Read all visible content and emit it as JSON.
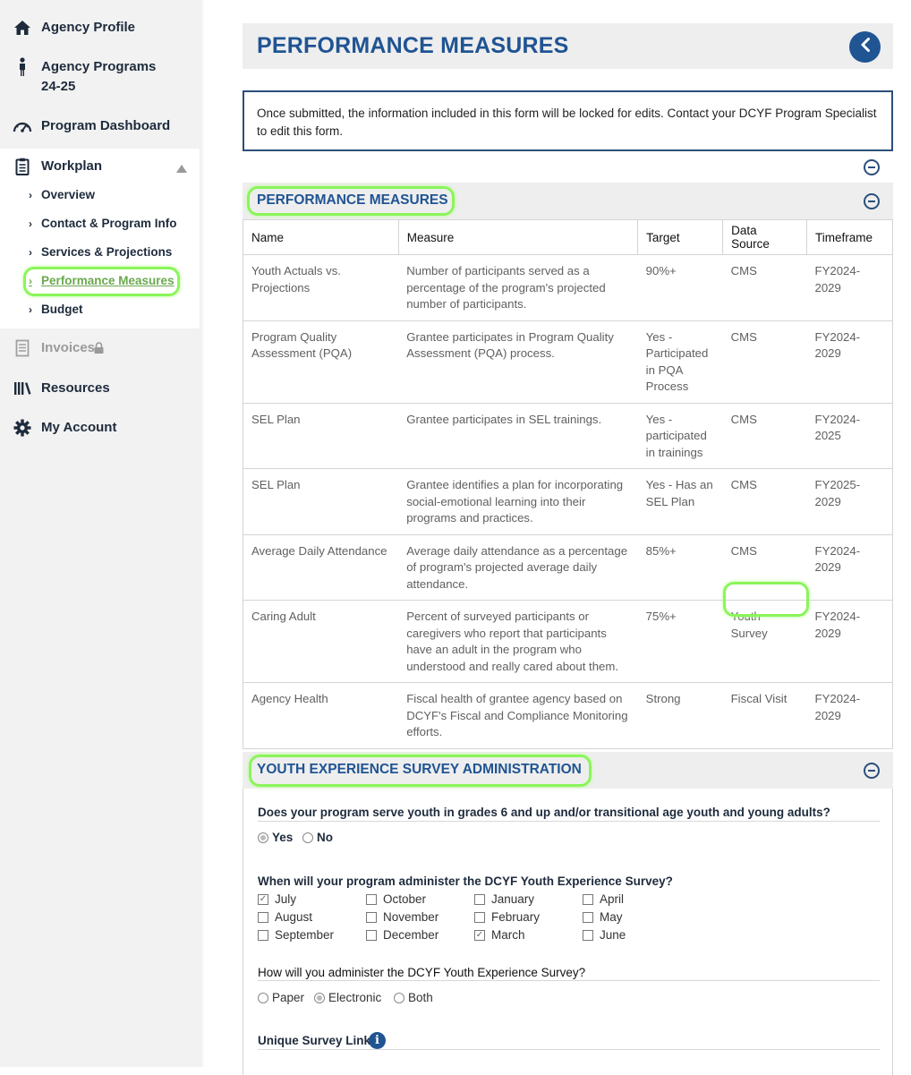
{
  "sidebar": {
    "items": [
      {
        "label": "Agency Profile",
        "icon": "home-icon"
      },
      {
        "label": "Agency Programs 24-25",
        "icon": "person-icon"
      },
      {
        "label": "Program Dashboard",
        "icon": "gauge-icon"
      },
      {
        "label": "Workplan",
        "icon": "clipboard-icon"
      },
      {
        "label": "Invoices",
        "icon": "invoice-icon",
        "locked": true
      },
      {
        "label": "Resources",
        "icon": "books-icon"
      },
      {
        "label": "My Account",
        "icon": "gear-icon"
      }
    ],
    "workplan_sub": [
      {
        "label": "Overview"
      },
      {
        "label": "Contact & Program Info"
      },
      {
        "label": "Services & Projections"
      },
      {
        "label": "Performance Measures",
        "active": true
      },
      {
        "label": "Budget"
      }
    ],
    "agency_programs_line1": "Agency Programs",
    "agency_programs_line2": "24-25"
  },
  "header": {
    "title": "PERFORMANCE MEASURES"
  },
  "notice": {
    "text": "Once submitted, the information included in this form will be locked for edits. Contact your DCYF Program Specialist to edit this form."
  },
  "performance_section": {
    "title": "PERFORMANCE MEASURES",
    "columns": [
      "Name",
      "Measure",
      "Target",
      "Data Source",
      "Timeframe"
    ],
    "rows": [
      {
        "name": "Youth Actuals vs. Projections",
        "measure": "Number of participants served as a percentage of the program's projected number of participants.",
        "target": "90%+",
        "source": "CMS",
        "timeframe": "FY2024-2029"
      },
      {
        "name": "Program Quality Assessment (PQA)",
        "measure": "Grantee participates in Program Quality Assessment (PQA) process.",
        "target": "Yes - Participated in PQA Process",
        "source": "CMS",
        "timeframe": "FY2024-2029"
      },
      {
        "name": "SEL Plan",
        "measure": "Grantee participates in SEL trainings.",
        "target": "Yes - participated in trainings",
        "source": "CMS",
        "timeframe": "FY2024-2025"
      },
      {
        "name": "SEL Plan",
        "measure": "Grantee identifies a plan for incorporating social-emotional learning into their programs and practices.",
        "target": "Yes - Has an SEL Plan",
        "source": "CMS",
        "timeframe": "FY2025-2029"
      },
      {
        "name": "Average Daily Attendance",
        "measure": "Average daily attendance as a percentage of program's projected average daily attendance.",
        "target": "85%+",
        "source": "CMS",
        "timeframe": "FY2024-2029"
      },
      {
        "name": "Caring Adult",
        "measure": "Percent of surveyed participants or caregivers who report that participants have an adult in the program who understood and really cared about them.",
        "target": "75%+",
        "source": "Youth Survey",
        "timeframe": "FY2024-2029"
      },
      {
        "name": "Agency Health",
        "measure": "Fiscal health of grantee agency based on DCYF's Fiscal and Compliance Monitoring efforts.",
        "target": "Strong",
        "source": "Fiscal Visit",
        "timeframe": "FY2024-2029"
      }
    ]
  },
  "survey_section": {
    "title": "YOUTH EXPERIENCE SURVEY ADMINISTRATION",
    "q1": {
      "label": "Does your program serve youth in grades 6 and up and/or transitional age youth and young adults?",
      "options": [
        "Yes",
        "No"
      ],
      "selected": "Yes"
    },
    "q2": {
      "label": "When will your program administer the DCYF Youth Experience Survey?",
      "months": [
        "July",
        "August",
        "September",
        "October",
        "November",
        "December",
        "January",
        "February",
        "March",
        "April",
        "May",
        "June"
      ],
      "checked": [
        "July",
        "March"
      ]
    },
    "q3": {
      "label": "How will you administer the DCYF Youth Experience Survey?",
      "options": [
        "Paper",
        "Electronic",
        "Both"
      ],
      "selected": "Electronic"
    },
    "q4": {
      "label": "Unique Survey Link"
    }
  },
  "colors": {
    "accent": "#205493",
    "highlight": "#8af55a",
    "active_link": "#6aa84f"
  }
}
